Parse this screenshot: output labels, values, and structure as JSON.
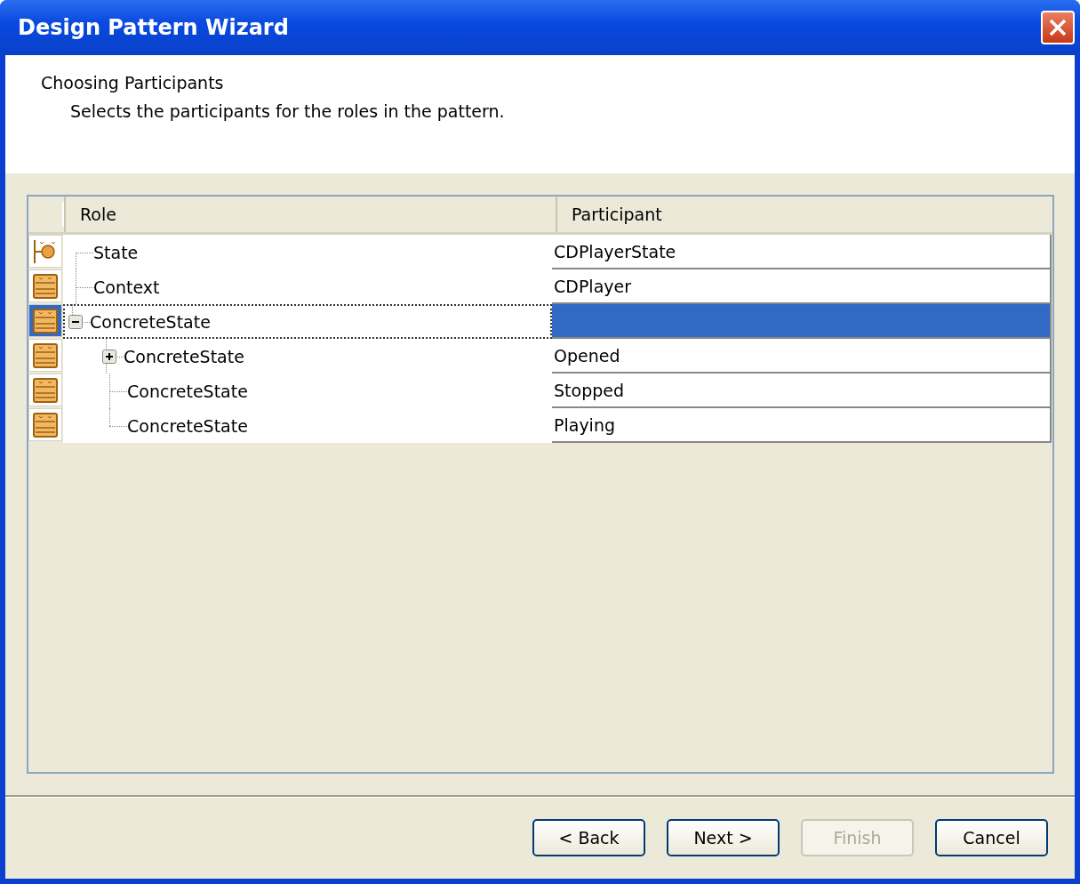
{
  "window": {
    "title": "Design Pattern Wizard"
  },
  "header": {
    "title": "Choosing Participants",
    "description": "Selects the participants for the roles in the pattern."
  },
  "table": {
    "columns": [
      "Role",
      "Participant"
    ],
    "rows": [
      {
        "role": "State",
        "participant": "CDPlayerState",
        "kind": "interface",
        "selected": false
      },
      {
        "role": "Context",
        "participant": "CDPlayer",
        "kind": "class",
        "selected": false
      },
      {
        "role": "ConcreteState",
        "participant": "",
        "kind": "class",
        "selected": true,
        "expanded": true,
        "children": [
          {
            "role": "ConcreteState",
            "participant": "Opened",
            "kind": "class",
            "selected": false,
            "expanded": false
          },
          {
            "role": "ConcreteState",
            "participant": "Stopped",
            "kind": "class",
            "selected": false
          },
          {
            "role": "ConcreteState",
            "participant": "Playing",
            "kind": "class",
            "selected": false
          }
        ]
      }
    ]
  },
  "buttons": [
    {
      "label": "< Back",
      "disabled": false
    },
    {
      "label": "Next >",
      "disabled": false
    },
    {
      "label": "Finish",
      "disabled": true
    },
    {
      "label": "Cancel",
      "disabled": false
    }
  ]
}
